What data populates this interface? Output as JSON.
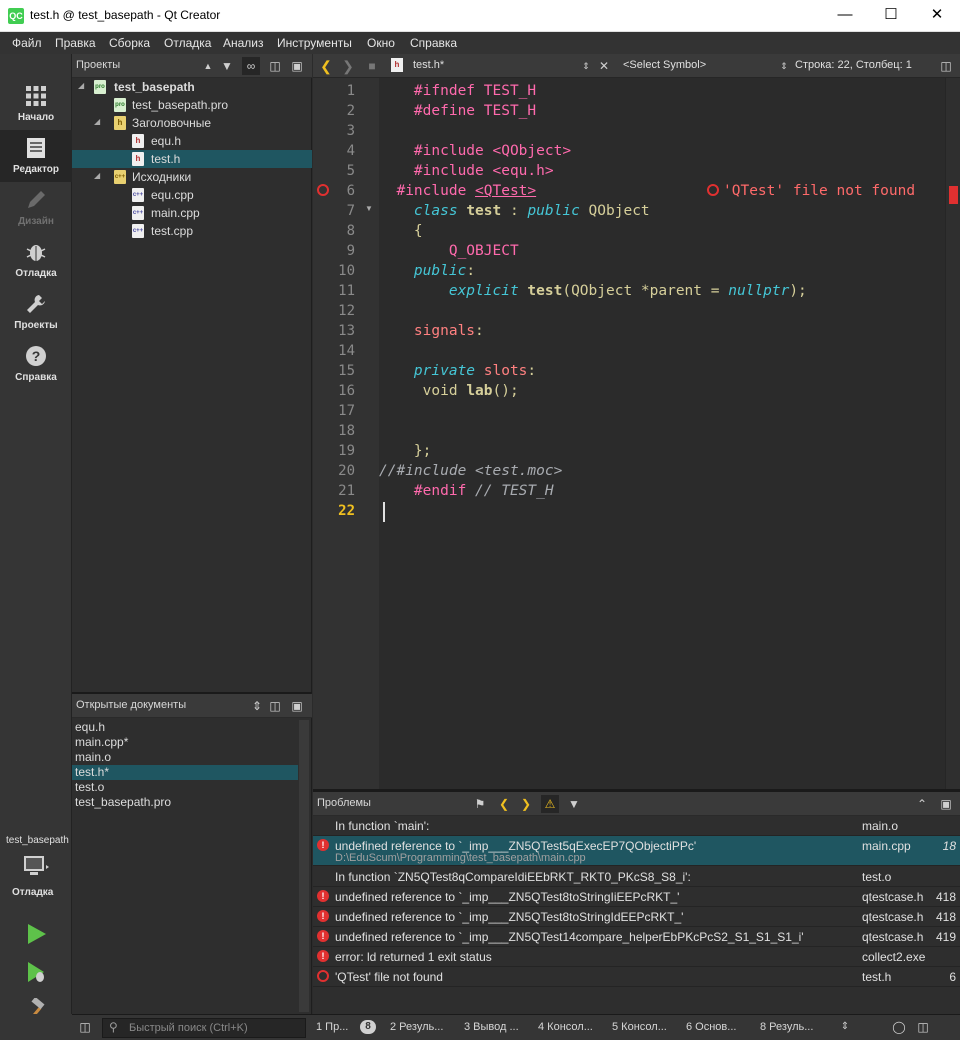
{
  "window": {
    "title": "test.h @ test_basepath - Qt Creator",
    "logo": "QC"
  },
  "menu": [
    "Файл",
    "Правка",
    "Сборка",
    "Отладка",
    "Анализ",
    "Инструменты",
    "Окно",
    "Справка"
  ],
  "modes": [
    {
      "label": "Начало",
      "icon": "grid-icon"
    },
    {
      "label": "Редактор",
      "icon": "editor-icon"
    },
    {
      "label": "Дизайн",
      "icon": "design-icon"
    },
    {
      "label": "Отладка",
      "icon": "bug-icon"
    },
    {
      "label": "Проекты",
      "icon": "wrench-icon"
    },
    {
      "label": "Справка",
      "icon": "help-icon"
    }
  ],
  "kit": {
    "project": "test_basepath",
    "mode": "Отладка"
  },
  "projects_panel": {
    "title": "Проекты",
    "tree": [
      {
        "label": "test_basepath",
        "type": "pro",
        "level": 0,
        "expanded": true,
        "bold": true
      },
      {
        "label": "test_basepath.pro",
        "type": "pro",
        "level": 1
      },
      {
        "label": "Заголовочные",
        "type": "folder",
        "level": 1,
        "expanded": true
      },
      {
        "label": "equ.h",
        "type": "h",
        "level": 2
      },
      {
        "label": "test.h",
        "type": "h",
        "level": 2,
        "selected": true
      },
      {
        "label": "Исходники",
        "type": "folder",
        "level": 1,
        "expanded": true
      },
      {
        "label": "equ.cpp",
        "type": "cpp",
        "level": 2
      },
      {
        "label": "main.cpp",
        "type": "cpp",
        "level": 2
      },
      {
        "label": "test.cpp",
        "type": "cpp",
        "level": 2
      }
    ]
  },
  "open_documents": {
    "title": "Открытые документы",
    "items": [
      "equ.h",
      "main.cpp*",
      "main.o",
      "test.h*",
      "test.o",
      "test_basepath.pro"
    ],
    "selected_index": 3
  },
  "editor_toolbar": {
    "file": "test.h*",
    "symbol": "<Select Symbol>",
    "position": "Строка: 22, Столбец: 1"
  },
  "editor": {
    "current_line": 22,
    "error_annotation": "'QTest' file not found",
    "line_numbers": [
      "1",
      "2",
      "3",
      "4",
      "5",
      "6",
      "7",
      "8",
      "9",
      "10",
      "11",
      "12",
      "13",
      "14",
      "15",
      "16",
      "17",
      "18",
      "19",
      "20",
      "21",
      "22"
    ]
  },
  "problems": {
    "title": "Проблемы",
    "rows": [
      {
        "icon": "none",
        "message": "In function `main':",
        "sub": "",
        "file": "main.o",
        "line": ""
      },
      {
        "icon": "error",
        "message": "undefined reference to `_imp___ZN5QTest5qExecEP7QObjectiPPc'",
        "sub": "D:\\EduScum\\Programming\\test_basepath\\main.cpp",
        "file": "main.cpp",
        "line": "18",
        "selected": true
      },
      {
        "icon": "none",
        "message": "In function `ZN5QTest8qCompareIdiEEbRKT_RKT0_PKcS8_S8_i':",
        "sub": "",
        "file": "test.o",
        "line": ""
      },
      {
        "icon": "error",
        "message": "undefined reference to `_imp___ZN5QTest8toStringIiEEPcRKT_'",
        "sub": "",
        "file": "qtestcase.h",
        "line": "418"
      },
      {
        "icon": "error",
        "message": "undefined reference to `_imp___ZN5QTest8toStringIdEEPcRKT_'",
        "sub": "",
        "file": "qtestcase.h",
        "line": "418"
      },
      {
        "icon": "error",
        "message": "undefined reference to `_imp___ZN5QTest14compare_helperEbPKcPcS2_S1_S1_S1_i'",
        "sub": "",
        "file": "qtestcase.h",
        "line": "419"
      },
      {
        "icon": "error",
        "message": "error: ld returned 1 exit status",
        "sub": "",
        "file": "collect2.exe",
        "line": ""
      },
      {
        "icon": "warning-ring",
        "message": "'QTest' file not found",
        "sub": "",
        "file": "test.h",
        "line": "6"
      }
    ]
  },
  "statusbar": {
    "search_placeholder": "Быстрый поиск (Ctrl+K)",
    "tabs": [
      {
        "label": "1 Пр...",
        "badge": "8"
      },
      {
        "label": "2 Резуль..."
      },
      {
        "label": "3 Вывод ..."
      },
      {
        "label": "4 Консол..."
      },
      {
        "label": "5 Консол..."
      },
      {
        "label": "6 Основ..."
      },
      {
        "label": "8 Резуль..."
      }
    ]
  },
  "colors": {
    "accent": "#1f5661",
    "error": "#e03030",
    "preprocessor": "#ff6aad",
    "keyword": "#45c6d6"
  }
}
